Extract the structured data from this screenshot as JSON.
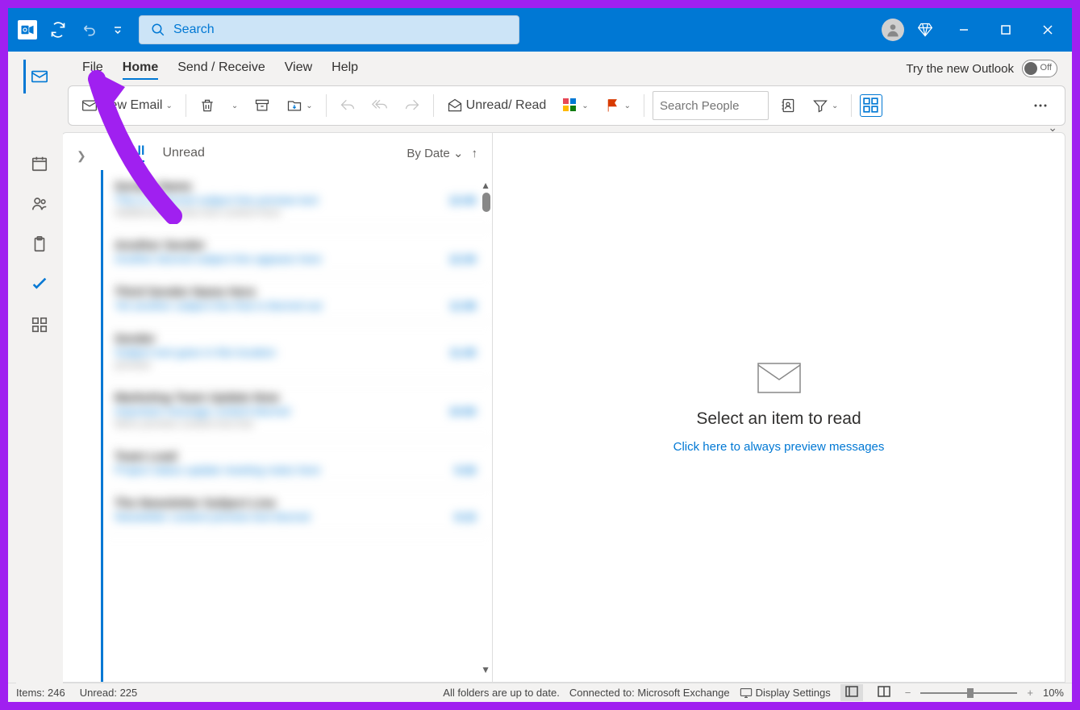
{
  "titlebar": {
    "search_placeholder": "Search"
  },
  "menubar": {
    "items": [
      "File",
      "Home",
      "Send / Receive",
      "View",
      "Help"
    ],
    "try_new_label": "Try the new Outlook",
    "toggle_state": "Off"
  },
  "ribbon": {
    "new_email_label": "New Email",
    "unread_read_label": "Unread/ Read",
    "search_people_placeholder": "Search People"
  },
  "msglist": {
    "tab_all": "All",
    "tab_unread": "Unread",
    "sort_label": "By Date"
  },
  "reading_pane": {
    "title": "Select an item to read",
    "link": "Click here to always preview messages"
  },
  "statusbar": {
    "items_label": "Items: 246",
    "unread_label": "Unread: 225",
    "folders_status": "All folders are up to date.",
    "connected_label": "Connected to: Microsoft Exchange",
    "display_settings": "Display Settings",
    "zoom_label": "10%"
  },
  "messages": [
    {
      "sender": "Sender Name",
      "subject": "This is a blurred subject line preview text",
      "time": "12:45",
      "preview": "Additional preview text content here"
    },
    {
      "sender": "Another Sender",
      "subject": "Another blurred subject line appears here",
      "time": "12:30",
      "preview": ""
    },
    {
      "sender": "Third Sender Name Here",
      "subject": "Yet another subject line that is blurred out",
      "time": "11:58",
      "preview": ""
    },
    {
      "sender": "Sender",
      "subject": "Subject text goes in this location",
      "time": "11:45",
      "preview": "preview"
    },
    {
      "sender": "Marketing Team Update Now",
      "subject": "Important message content blurred",
      "time": "10:50",
      "preview": "More preview content text line"
    },
    {
      "sender": "Team Lead",
      "subject": "Project status update meeting notes here",
      "time": "9:30",
      "preview": ""
    },
    {
      "sender": "The Newsletter Subject Line",
      "subject": "Newsletter content preview text blurred",
      "time": "8:15",
      "preview": ""
    }
  ]
}
